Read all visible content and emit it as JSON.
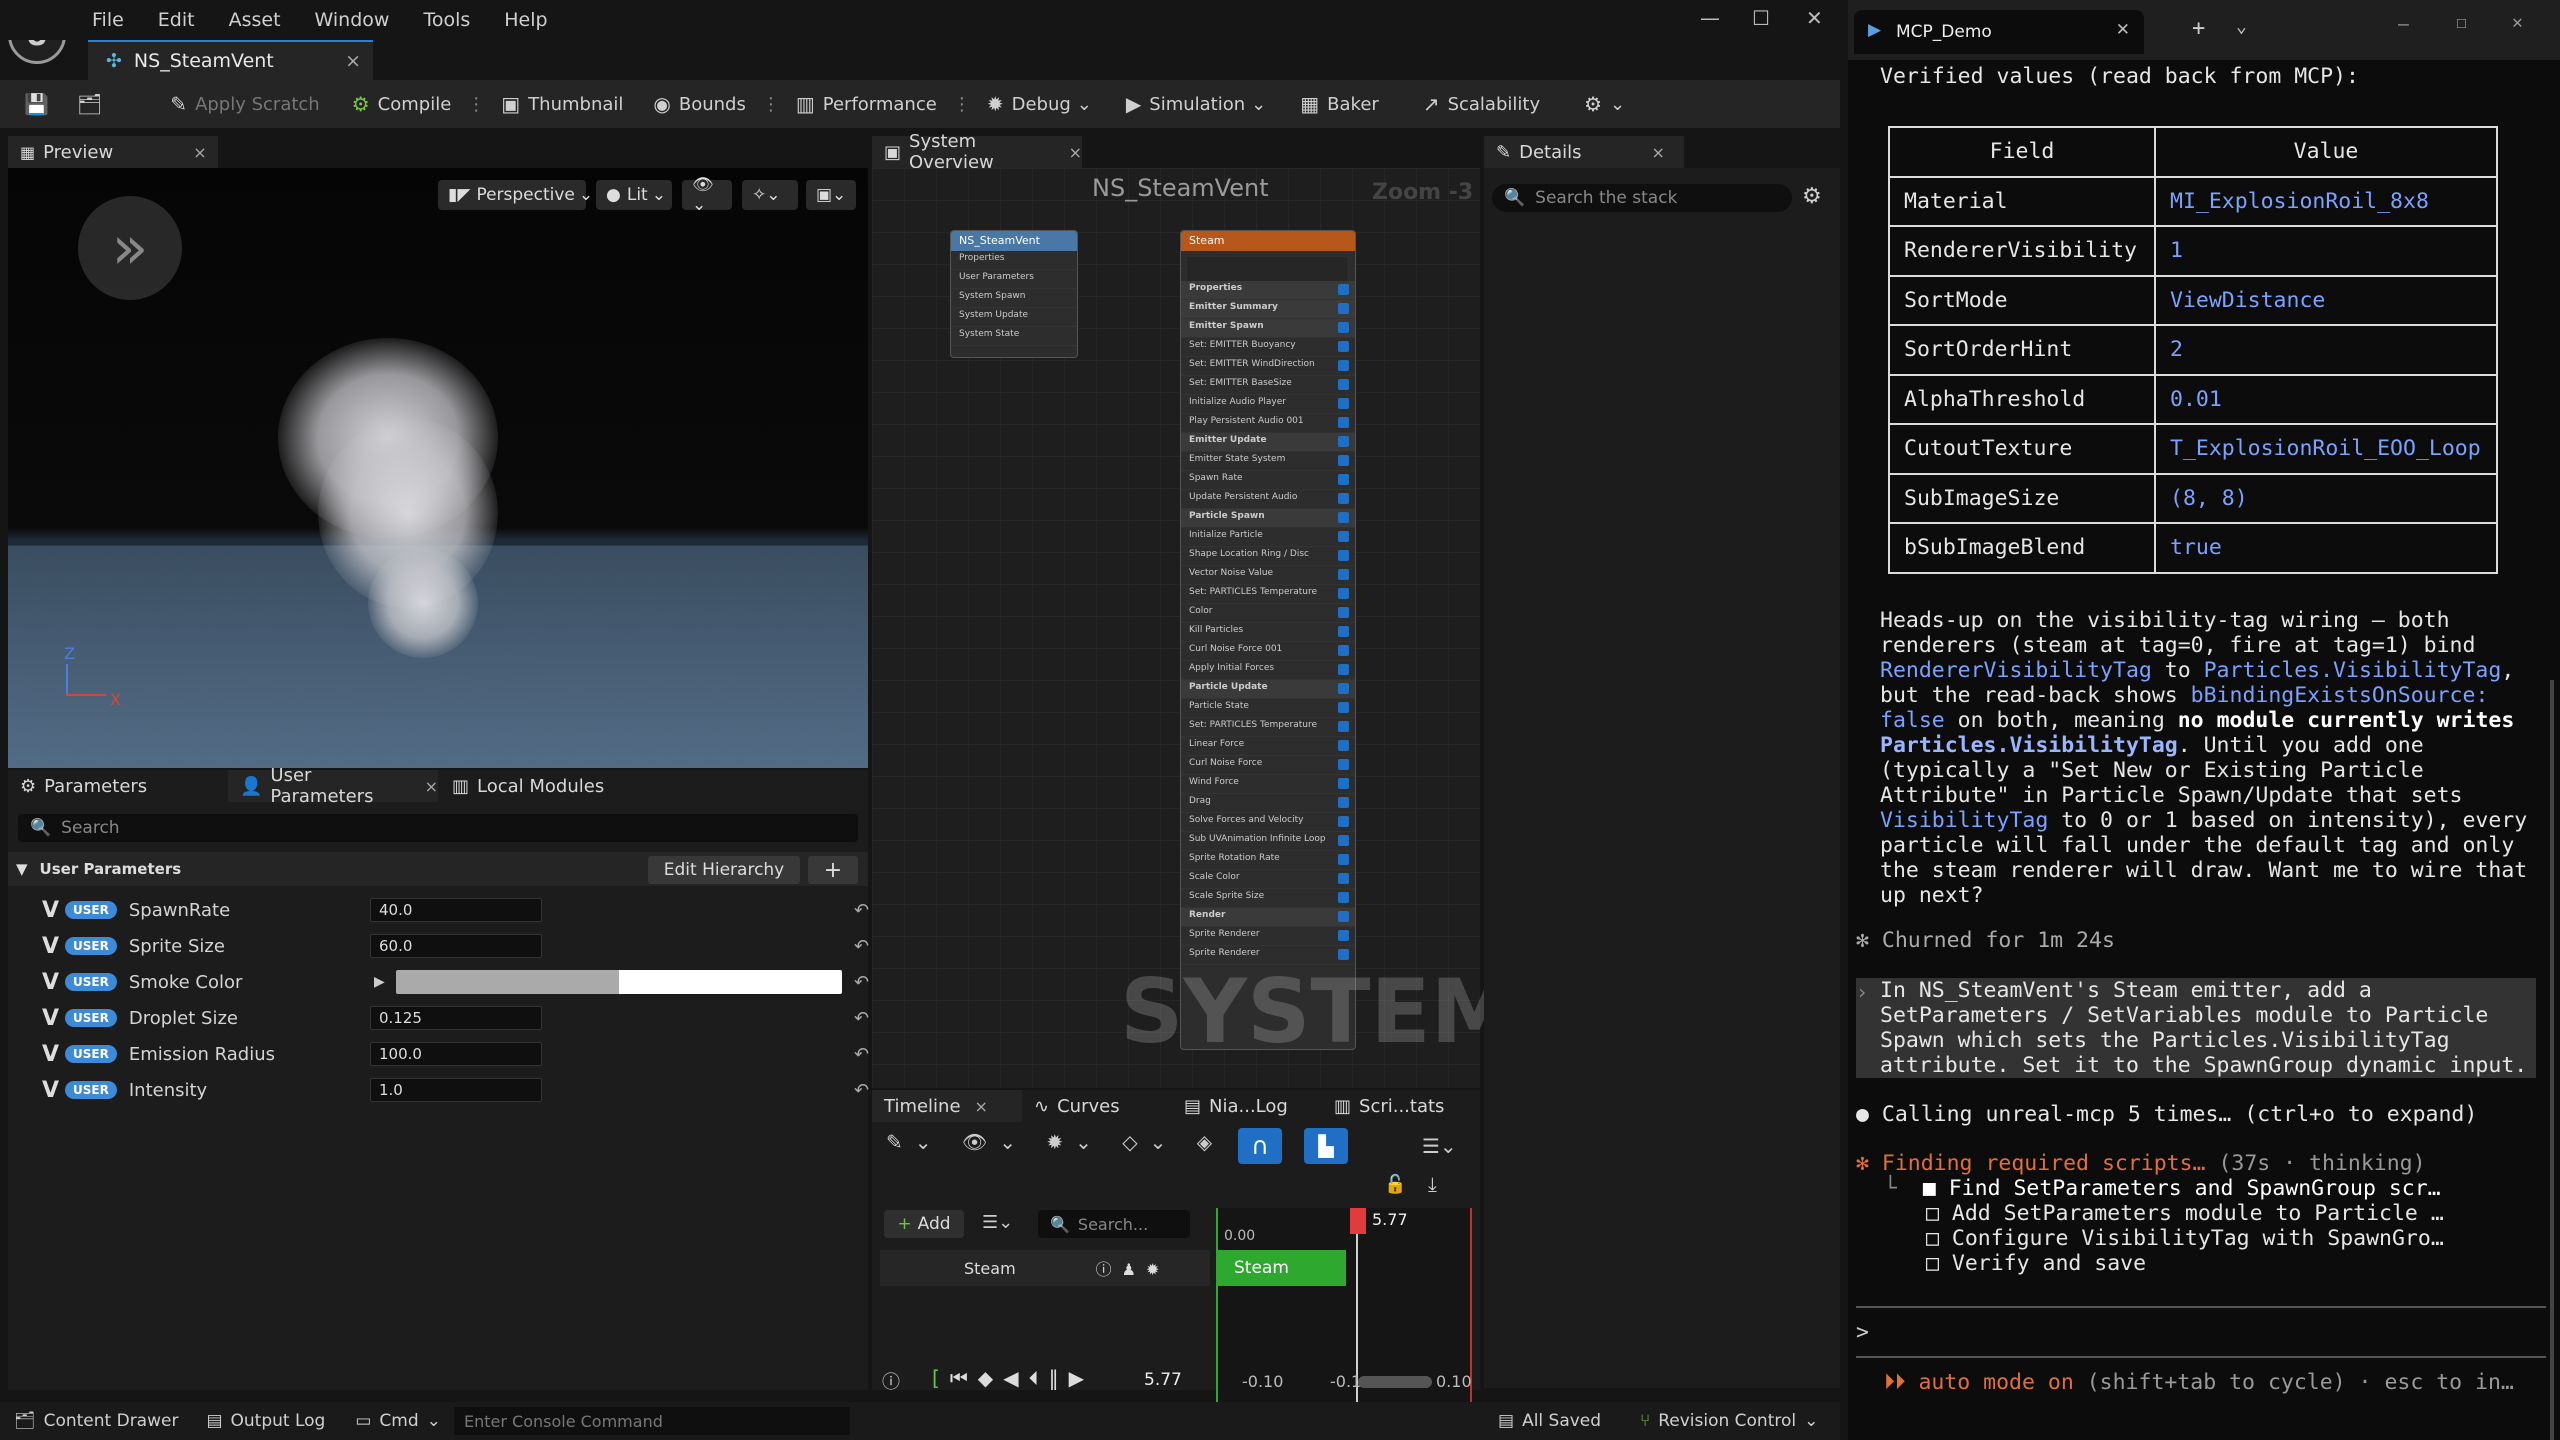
{
  "menu": [
    "File",
    "Edit",
    "Asset",
    "Window",
    "Tools",
    "Help"
  ],
  "doc_tab": {
    "label": "NS_SteamVent",
    "close": "×"
  },
  "toolbar": {
    "apply_scratch": "Apply Scratch",
    "compile": "Compile",
    "thumbnail": "Thumbnail",
    "bounds": "Bounds",
    "performance": "Performance",
    "debug": "Debug",
    "simulation": "Simulation",
    "baker": "Baker",
    "scalability": "Scalability"
  },
  "preview": {
    "tab": "Preview",
    "perspective": "Perspective",
    "lit": "Lit",
    "axis_z": "Z",
    "axis_x": "X"
  },
  "params_panel": {
    "tabs": [
      "Parameters",
      "User Parameters",
      "Local Modules"
    ],
    "search_placeholder": "Search",
    "section": "User Parameters",
    "edit_hierarchy": "Edit Hierarchy",
    "badge": "USER",
    "rows": [
      {
        "name": "SpawnRate",
        "value": "40.0"
      },
      {
        "name": "Sprite Size",
        "value": "60.0"
      },
      {
        "name": "Smoke Color",
        "value": ""
      },
      {
        "name": "Droplet Size",
        "value": "0.125"
      },
      {
        "name": "Emission Radius",
        "value": "100.0"
      },
      {
        "name": "Intensity",
        "value": "1.0"
      }
    ]
  },
  "graph": {
    "tab": "System Overview",
    "title": "NS_SteamVent",
    "zoom": "Zoom -3",
    "watermark": "SYSTEM",
    "system_node": {
      "title": "NS_SteamVent",
      "rows": [
        "Properties",
        "User Parameters",
        "System Spawn",
        "System Update",
        "System State"
      ]
    },
    "emitter_node": {
      "title": "Steam",
      "rows": [
        "Properties",
        "Emitter Summary",
        "Emitter Spawn",
        "Set: EMITTER Buoyancy",
        "Set: EMITTER WindDirection",
        "Set: EMITTER BaseSize",
        "Initialize Audio Player",
        "Play Persistent Audio 001",
        "Emitter Update",
        "Emitter State System",
        "Spawn Rate",
        "Update Persistent Audio",
        "Particle Spawn",
        "Initialize Particle",
        "Shape Location Ring / Disc",
        "Vector Noise Value",
        "Set: PARTICLES Temperature",
        "Color",
        "Kill Particles",
        "Curl Noise Force 001",
        "Apply Initial Forces",
        "Particle Update",
        "Particle State",
        "Set: PARTICLES Temperature",
        "Linear Force",
        "Curl Noise Force",
        "Wind Force",
        "Drag",
        "Solve Forces and Velocity",
        "Sub UVAnimation Infinite Loop",
        "Sprite Rotation Rate",
        "Scale Color",
        "Scale Sprite Size",
        "Render",
        "Sprite Renderer",
        "Sprite Renderer"
      ]
    }
  },
  "details": {
    "tab": "Details",
    "search_placeholder": "Search the stack"
  },
  "timeline": {
    "tabs": [
      "Timeline",
      "Curves",
      "Nia...Log",
      "Scri...tats"
    ],
    "add": "Add",
    "search_placeholder": "Search...",
    "track": "Steam",
    "clip": "Steam",
    "time_start": "0.00",
    "playhead": "5.77",
    "time_value": "5.77",
    "range_min": "-0.10",
    "range_mid": "-0.1",
    "range_max": "0.10"
  },
  "statusbar": {
    "content_drawer": "Content Drawer",
    "output_log": "Output Log",
    "cmd": "Cmd",
    "console_placeholder": "Enter Console Command",
    "all_saved": "All Saved",
    "revision_control": "Revision Control"
  },
  "terminal": {
    "tab": "MCP_Demo",
    "heading": "Verified values (read back from MCP):",
    "table_headers": [
      "Field",
      "Value"
    ],
    "table_rows": [
      [
        "Material",
        "MI_ExplosionRoil_8x8"
      ],
      [
        "RendererVisibility",
        "1"
      ],
      [
        "SortMode",
        "ViewDistance"
      ],
      [
        "SortOrderHint",
        "2"
      ],
      [
        "AlphaThreshold",
        "0.01"
      ],
      [
        "CutoutTexture",
        "T_ExplosionRoil_EOO_Loop"
      ],
      [
        "SubImageSize",
        "(8, 8)"
      ],
      [
        "bSubImageBlend",
        "true"
      ]
    ],
    "p1": "Heads-up on the visibility-tag wiring — both",
    "p2": "renderers (steam at tag=0, fire at tag=1) bind",
    "p3a": "RendererVisibilityTag",
    "p3b": " to ",
    "p3c": "Particles.VisibilityTag",
    ",p3d": ",",
    "p4a": "but the read-back shows ",
    "p4b": "bBindingExistsOnSource:",
    "p5a": "false",
    "p5b": " on both, meaning ",
    "p5c": "no module currently writes",
    "p6a": "Particles.VisibilityTag",
    "p6b": ". Until you add one",
    "p7": "(typically a \"Set New or Existing Particle",
    "p8": "Attribute\" in Particle Spawn/Update that sets",
    "p9a": "VisibilityTag",
    "p9b": " to 0 or 1 based on intensity), every",
    "p10": "particle will fall under the default tag and only",
    "p11": "the steam renderer will draw. Want me to wire that",
    "p12": "up next?",
    "churned": "✻ Churned for 1m 24s",
    "user1": "In NS_SteamVent's Steam emitter, add a",
    "user2": "SetParameters / SetVariables module to Particle",
    "user3": "Spawn which sets the Particles.VisibilityTag",
    "user4": "attribute. Set it to the SpawnGroup dynamic input.",
    "calling": "● Calling unreal-mcp 5 times… (ctrl+o to expand)",
    "finding": "✻ Finding required scripts… ",
    "finding_meta": "(37s · thinking)",
    "todo1": "■ Find SetParameters and SpawnGroup scr…",
    "todo2": "□ Add SetParameters module to Particle …",
    "todo3": "□ Configure VisibilityTag with SpawnGro…",
    "todo4": "□ Verify and save",
    "prompt": ">",
    "auto": "⏵⏵ auto mode on",
    "auto_hint": " (shift+tab to cycle) · esc to in…"
  },
  "colors": {
    "accent": "#2a7fd1",
    "user_badge": "#3d8ad6",
    "clip_green": "#2fa82f",
    "playhead_red": "#e03c3c",
    "term_blue": "#7aa2ff",
    "term_orange": "#e0703a"
  }
}
